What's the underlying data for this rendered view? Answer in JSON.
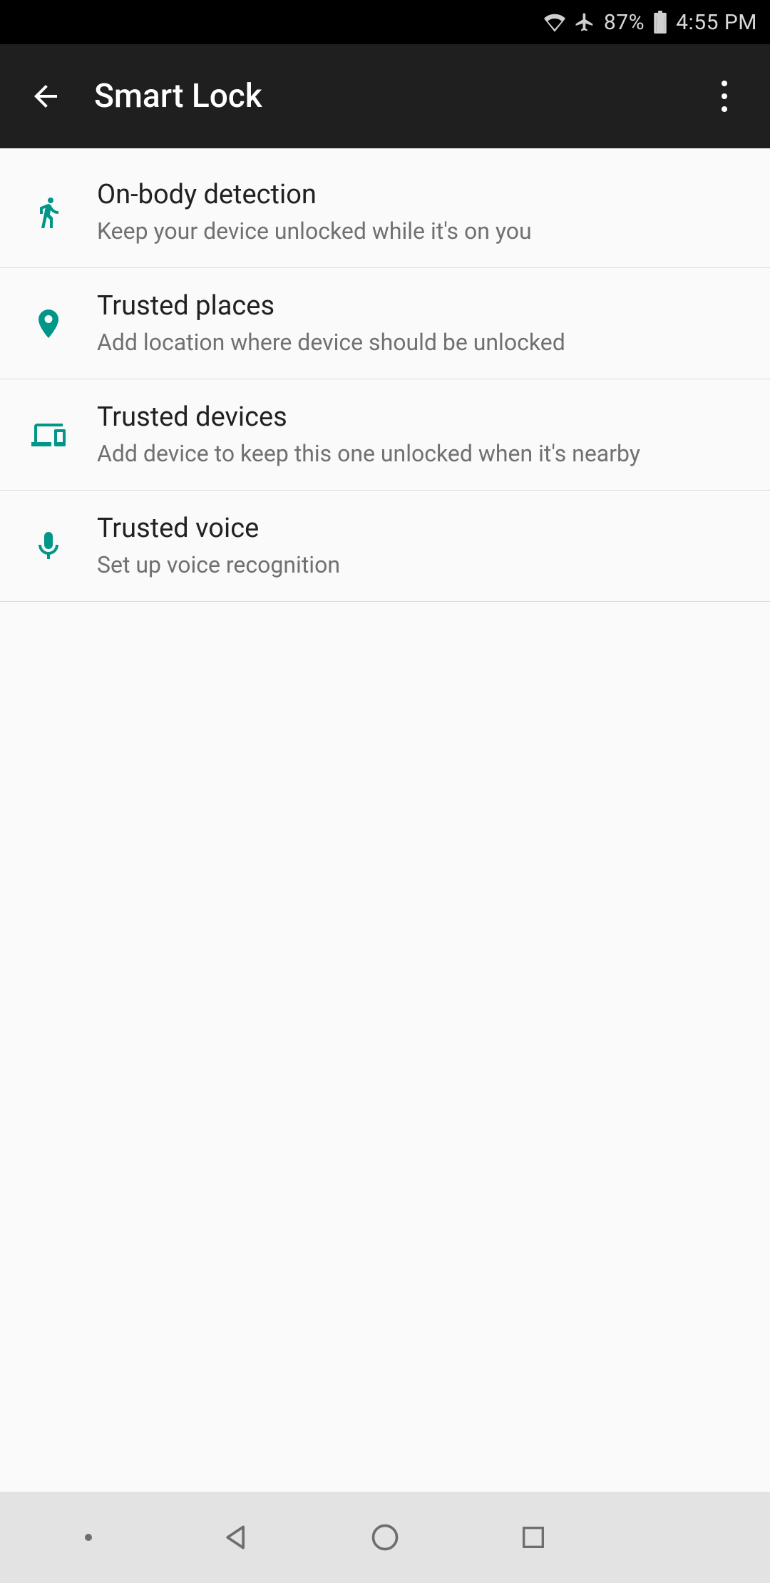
{
  "status": {
    "battery_pct": "87%",
    "time": "4:55 PM"
  },
  "appbar": {
    "title": "Smart Lock"
  },
  "items": [
    {
      "icon": "walk-icon",
      "title": "On-body detection",
      "subtitle": "Keep your device unlocked while it's on you"
    },
    {
      "icon": "place-icon",
      "title": "Trusted places",
      "subtitle": "Add location where device should be unlocked"
    },
    {
      "icon": "devices-icon",
      "title": "Trusted devices",
      "subtitle": "Add device to keep this one unlocked when it's nearby"
    },
    {
      "icon": "mic-icon",
      "title": "Trusted voice",
      "subtitle": "Set up voice recognition"
    }
  ],
  "colors": {
    "accent": "#009688"
  }
}
